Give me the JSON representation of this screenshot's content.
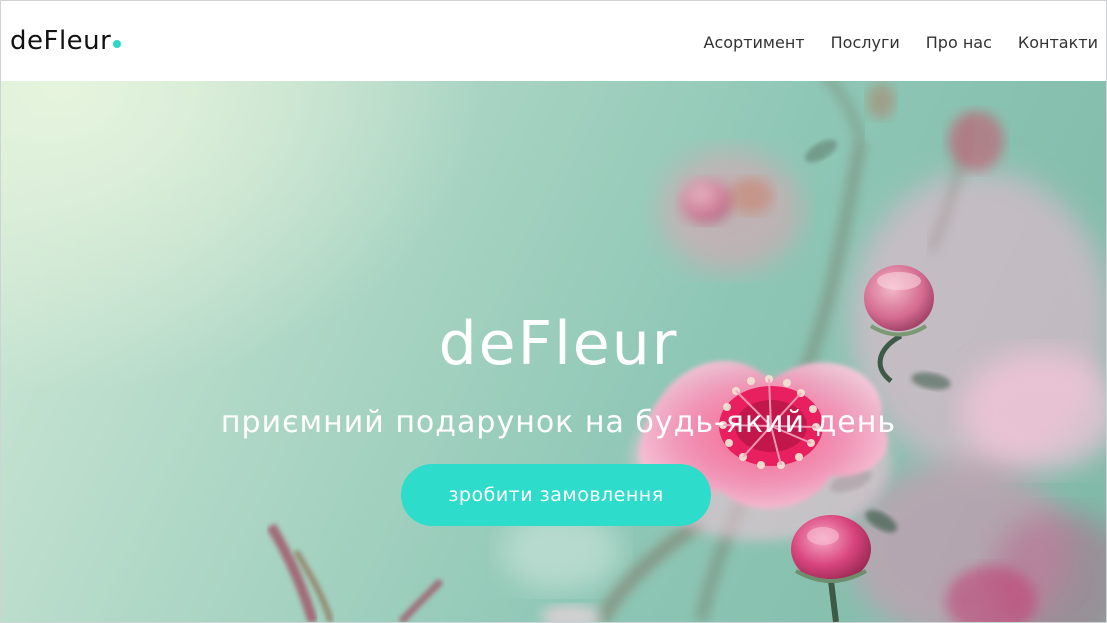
{
  "header": {
    "logo_text": "deFleur",
    "nav": [
      {
        "label": "Асортимент"
      },
      {
        "label": "Послуги"
      },
      {
        "label": "Про нас"
      },
      {
        "label": "Контакти"
      }
    ]
  },
  "hero": {
    "title": "deFleur",
    "subtitle": "приємний подарунок на будь-який день",
    "cta_label": "зробити замовлення"
  },
  "colors": {
    "accent": "#2ddccb",
    "logo_dot": "#2ad9c9",
    "text_dark": "#111111",
    "hero_text": "#ffffff"
  }
}
